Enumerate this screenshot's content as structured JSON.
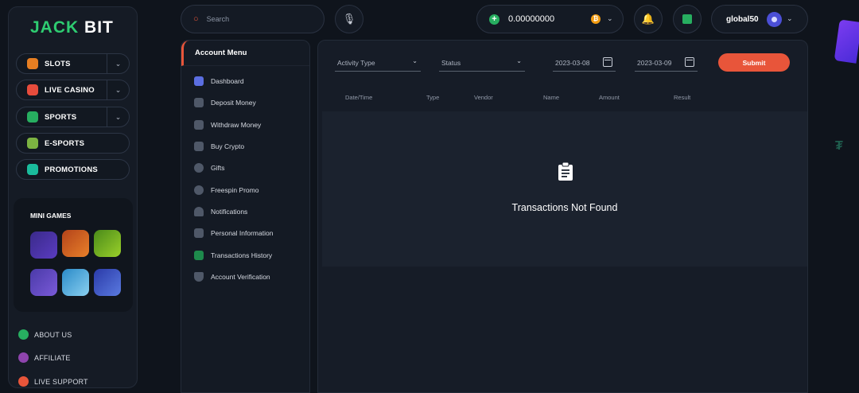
{
  "brand": {
    "logo_part1": "JACK",
    "logo_part2": "BIT"
  },
  "sidebar": {
    "nav": [
      {
        "label": "SLOTS",
        "icon": "slots-icon",
        "color": "#e67e22",
        "has_dropdown": true
      },
      {
        "label": "LIVE CASINO",
        "icon": "live-casino-icon",
        "color": "#e74c3c",
        "has_dropdown": true
      },
      {
        "label": "SPORTS",
        "icon": "sports-icon",
        "color": "#27ae60",
        "has_dropdown": true
      },
      {
        "label": "E-SPORTS",
        "icon": "esports-icon",
        "color": "#7cb342",
        "has_dropdown": false
      },
      {
        "label": "PROMOTIONS",
        "icon": "promotions-icon",
        "color": "#1abc9c",
        "has_dropdown": false
      }
    ],
    "mini_games_title": "MINI GAMES",
    "footer": [
      {
        "label": "ABOUT US",
        "icon": "about-us-icon",
        "color": "#27ae60"
      },
      {
        "label": "AFFILIATE",
        "icon": "affiliate-icon",
        "color": "#8e44ad"
      },
      {
        "label": "LIVE SUPPORT",
        "icon": "live-support-icon",
        "color": "#e8553a"
      }
    ]
  },
  "topbar": {
    "search_placeholder": "Search",
    "balance": "0.00000000",
    "currency_icon": "bitcoin-icon",
    "username": "global50"
  },
  "account_menu": {
    "title": "Account Menu",
    "items": [
      {
        "label": "Dashboard",
        "icon": "dashboard-icon",
        "color": "#5b6ee1"
      },
      {
        "label": "Deposit Money",
        "icon": "deposit-icon",
        "color": "#6a7383"
      },
      {
        "label": "Withdraw Money",
        "icon": "withdraw-icon",
        "color": "#6a7383"
      },
      {
        "label": "Buy Crypto",
        "icon": "cart-icon",
        "color": "#6a7383"
      },
      {
        "label": "Gifts",
        "icon": "gift-icon",
        "color": "#6a7383"
      },
      {
        "label": "Freespin Promo",
        "icon": "freespin-icon",
        "color": "#6a7383"
      },
      {
        "label": "Notifications",
        "icon": "bell-icon",
        "color": "#6a7383"
      },
      {
        "label": "Personal Information",
        "icon": "person-icon",
        "color": "#6a7383"
      },
      {
        "label": "Transactions History",
        "icon": "transactions-icon",
        "color": "#1e8a4c"
      },
      {
        "label": "Account Verification",
        "icon": "shield-icon",
        "color": "#6a7383"
      }
    ]
  },
  "filters": {
    "activity_type": "Activity Type",
    "status": "Status",
    "date_from": "2023-03-08",
    "date_to": "2023-03-09",
    "submit_label": "Submit"
  },
  "table": {
    "columns": [
      "Date/Time",
      "Type",
      "Vendor",
      "Name",
      "Amount",
      "Result"
    ],
    "empty_message": "Transactions Not Found"
  },
  "colors": {
    "accent": "#e8553a",
    "brand_green": "#2ecc71"
  }
}
